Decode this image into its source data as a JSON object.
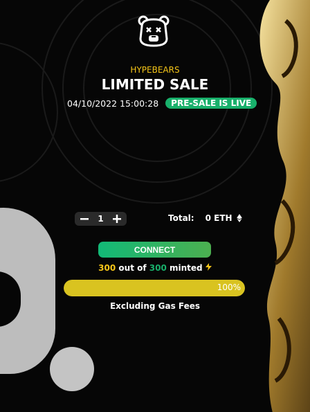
{
  "header": {
    "brand": "HYPEBEARS",
    "title": "LIMITED SALE",
    "datetime": "04/10/2022 15:00:28",
    "status_badge": "PRE-SALE IS LIVE"
  },
  "mint": {
    "quantity": "1",
    "total_label": "Total:",
    "total_value": "0 ETH",
    "connect_label": "CONNECT",
    "minted_count": "300",
    "minted_out_of": "out of",
    "minted_total": "300",
    "minted_suffix": "minted",
    "progress_percent": 100,
    "progress_label": "100%",
    "gas_note": "Excluding Gas Fees"
  },
  "colors": {
    "accent_yellow": "#f5c518",
    "accent_green": "#18b06b",
    "progress_fill": "#d9c320",
    "background": "#060606"
  },
  "icons": {
    "logo": "bear-face-icon",
    "minus": "minus-icon",
    "plus": "plus-icon",
    "eth": "ethereum-icon",
    "lightning": "lightning-icon"
  }
}
